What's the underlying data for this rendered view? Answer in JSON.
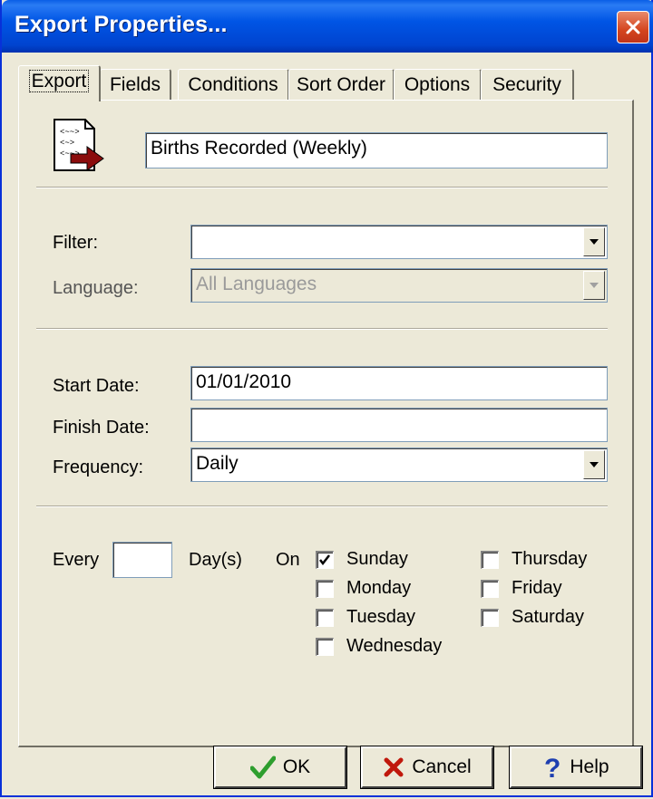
{
  "window": {
    "title": "Export Properties..."
  },
  "tabs": [
    {
      "label": "Export"
    },
    {
      "label": "Fields"
    },
    {
      "label": "Conditions"
    },
    {
      "label": "Sort Order"
    },
    {
      "label": "Options"
    },
    {
      "label": "Security"
    }
  ],
  "export": {
    "name_value": "Births Recorded (Weekly)",
    "filter": {
      "label": "Filter:",
      "value": ""
    },
    "language": {
      "label": "Language:",
      "value": "All Languages",
      "disabled": true
    },
    "start_date": {
      "label": "Start Date:",
      "value": "01/01/2010"
    },
    "finish_date": {
      "label": "Finish Date:",
      "value": ""
    },
    "frequency": {
      "label": "Frequency:",
      "value": "Daily"
    },
    "every": {
      "label": "Every",
      "value": "",
      "unit": "Day(s)"
    },
    "on_label": "On",
    "days": [
      {
        "label": "Sunday",
        "checked": true
      },
      {
        "label": "Monday",
        "checked": false
      },
      {
        "label": "Tuesday",
        "checked": false
      },
      {
        "label": "Wednesday",
        "checked": false
      },
      {
        "label": "Thursday",
        "checked": false
      },
      {
        "label": "Friday",
        "checked": false
      },
      {
        "label": "Saturday",
        "checked": false
      }
    ]
  },
  "buttons": {
    "ok": "OK",
    "cancel": "Cancel",
    "help": "Help"
  },
  "icons": {
    "close": "close-icon",
    "export_file": "export-file-icon",
    "ok": "checkmark-icon",
    "cancel": "x-icon",
    "help": "question-icon"
  },
  "colors": {
    "titlebar": "#0055e5",
    "ok_check": "#2e9e2e",
    "cancel_x": "#c0180c",
    "help_q": "#1e3fb0",
    "export_arrow": "#8b0c0c"
  }
}
